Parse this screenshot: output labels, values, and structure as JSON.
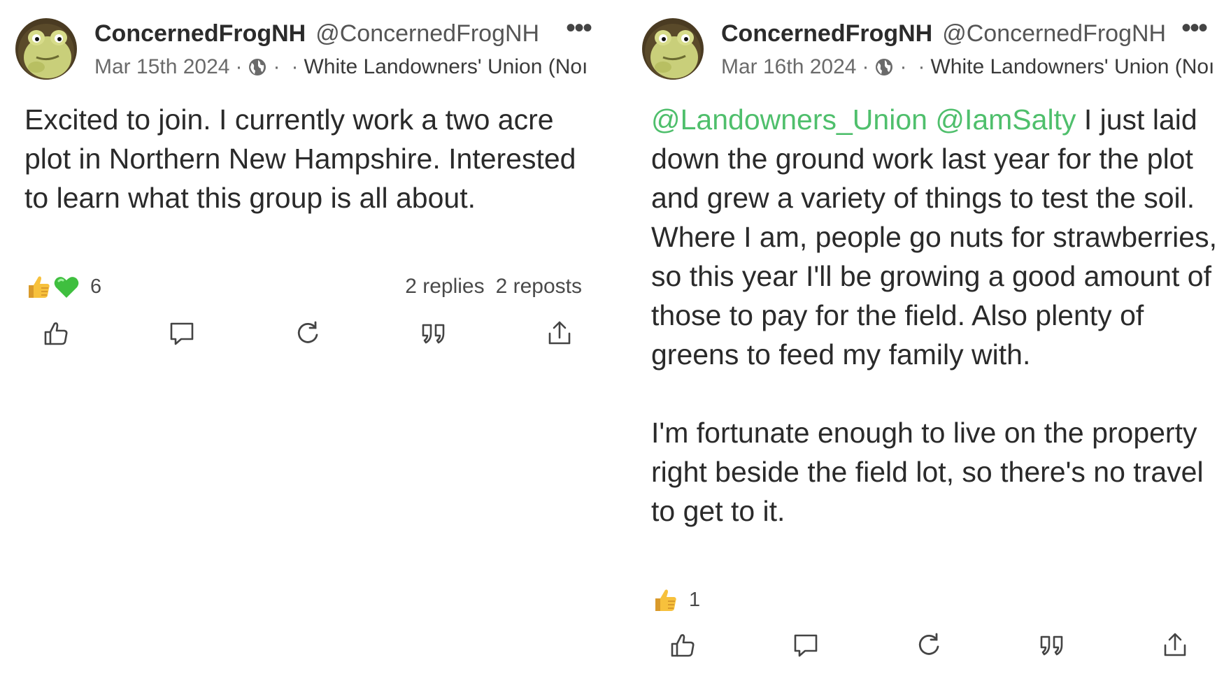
{
  "posts": [
    {
      "author": {
        "display_name": "ConcernedFrogNH",
        "handle": "@ConcernedFrogNH",
        "avatar_icon": "frog-avatar"
      },
      "date": "Mar 15th 2024",
      "visibility_icon": "globe-icon",
      "group": "White Landowners' Union (Noı",
      "body": "Excited to join. I currently work a two acre plot in Northern New Hampshire. Interested to learn what this group is all about.",
      "reactions": {
        "emojis": [
          "thumbs-up-emoji",
          "green-heart-emoji"
        ],
        "count": "6"
      },
      "stats": {
        "replies": "2 replies",
        "reposts": "2 reposts"
      },
      "actions": [
        "like",
        "reply",
        "repost",
        "quote",
        "share"
      ]
    },
    {
      "author": {
        "display_name": "ConcernedFrogNH",
        "handle": "@ConcernedFrogNH",
        "avatar_icon": "frog-avatar"
      },
      "date": "Mar 16th 2024",
      "visibility_icon": "globe-icon",
      "group": "White Landowners' Union (Noı",
      "mentions": [
        "@Landowners_Union",
        "@IamSalty"
      ],
      "body": " I just laid down the ground work last year for the plot and grew a variety of things to test the soil. Where I am, people go nuts for strawberries, so this year I'll be growing a good amount of those to pay for the field. Also plenty of greens to feed my family with.\n\nI'm fortunate enough to live on the property right beside the field lot, so there's no travel to get to it.",
      "reactions": {
        "emojis": [
          "thumbs-up-emoji"
        ],
        "count": "1"
      },
      "actions": [
        "like",
        "reply",
        "repost",
        "quote",
        "share"
      ]
    }
  ],
  "colors": {
    "mention": "#4fbf6c",
    "text": "#2a2a2a",
    "muted": "#6a6a6a",
    "background": "#ffffff"
  }
}
